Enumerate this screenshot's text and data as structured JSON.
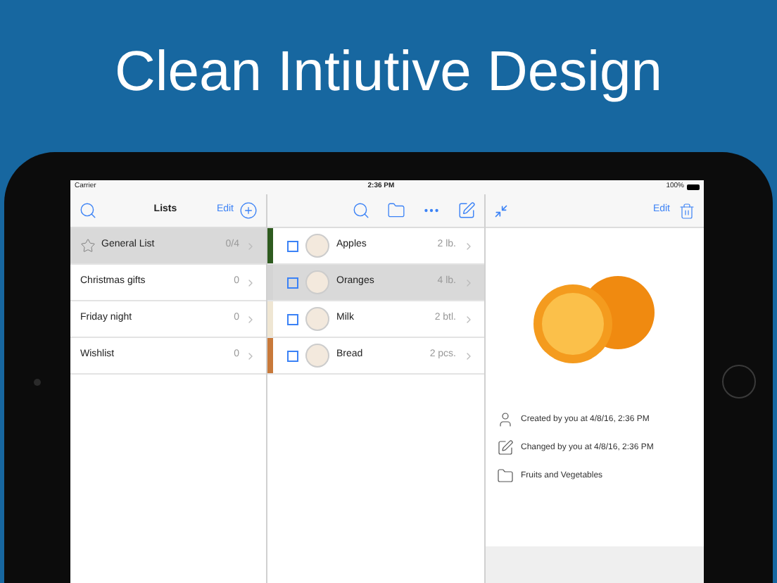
{
  "headline": "Clean Intiutive Design",
  "status_bar": {
    "carrier": "Carrier",
    "time": "2:36 PM",
    "battery": "100%"
  },
  "lists_panel": {
    "title": "Lists",
    "edit": "Edit",
    "items": [
      {
        "name": "General List",
        "count": "0/4",
        "selected": true,
        "starred": true
      },
      {
        "name": "Christmas gifts",
        "count": "0",
        "selected": false,
        "starred": false
      },
      {
        "name": "Friday night",
        "count": "0",
        "selected": false,
        "starred": false
      },
      {
        "name": "Wishlist",
        "count": "0",
        "selected": false,
        "starred": false
      }
    ]
  },
  "items_panel": {
    "items": [
      {
        "name": "Apples",
        "quantity": "2 lb.",
        "checked": false,
        "selected": false,
        "color": "#2e5b1f"
      },
      {
        "name": "Oranges",
        "quantity": "4 lb.",
        "checked": false,
        "selected": true,
        "color": "#d4d4d4"
      },
      {
        "name": "Milk",
        "quantity": "2 btl.",
        "checked": false,
        "selected": false,
        "color": "#efe6d3"
      },
      {
        "name": "Bread",
        "quantity": "2 pcs.",
        "checked": false,
        "selected": false,
        "color": "#c8793a"
      }
    ]
  },
  "detail_panel": {
    "edit": "Edit",
    "info": [
      {
        "kind": "creator",
        "text": "Created by you at 4/8/16, 2:36 PM"
      },
      {
        "kind": "editor",
        "text": "Changed by you at 4/8/16, 2:36 PM"
      },
      {
        "kind": "folder",
        "text": "Fruits and Vegetables"
      }
    ]
  }
}
